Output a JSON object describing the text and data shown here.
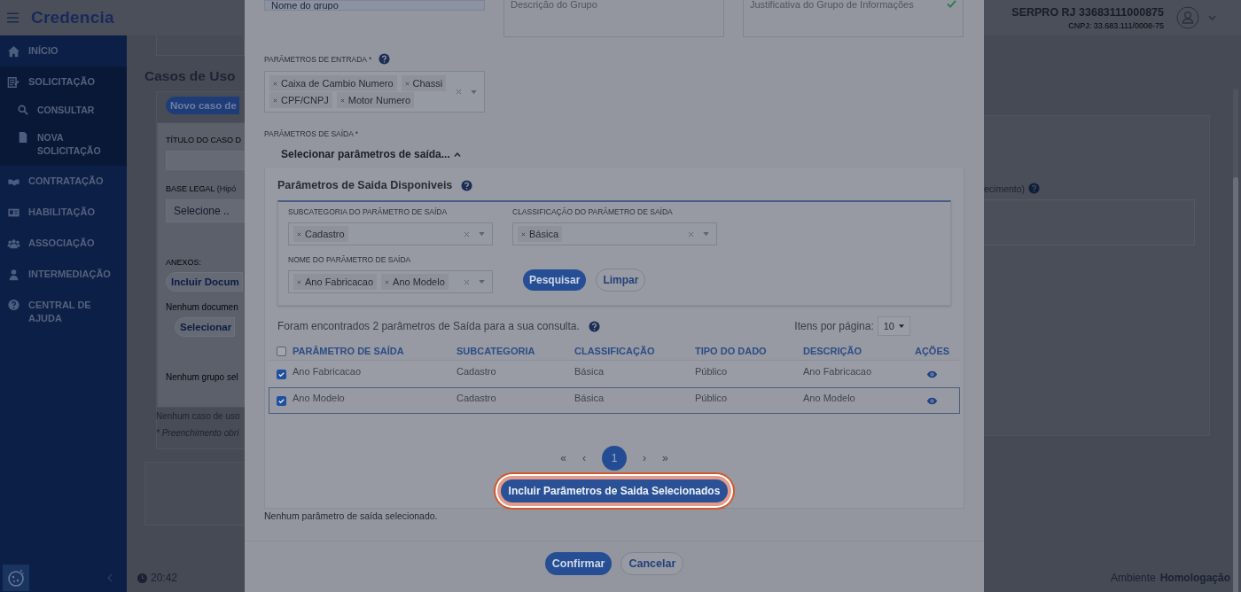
{
  "header": {
    "logo": "Credencia",
    "company_name": "SERPRO RJ 33683111000875",
    "company_id": "CNPJ: 33.683.111/0008-75"
  },
  "sidebar": {
    "items": [
      {
        "label": "INÍCIO",
        "expanded": false
      },
      {
        "label": "SOLICITAÇÃO",
        "expanded": true,
        "children": [
          {
            "label": "CONSULTAR"
          },
          {
            "label": "NOVA SOLICITAÇÃO"
          }
        ]
      },
      {
        "label": "CONTRATAÇÃO",
        "expanded": false
      },
      {
        "label": "HABILITAÇÃO",
        "expanded": false
      },
      {
        "label": "ASSOCIAÇÃO",
        "expanded": false
      },
      {
        "label": "INTERMEDIAÇÃO",
        "expanded": false
      },
      {
        "label": "CENTRAL DE AJUDA",
        "expanded": false
      }
    ]
  },
  "footer": {
    "time": "20:42",
    "environment_label": "Ambiente",
    "environment": "Homologação"
  },
  "background": {
    "section_title": "Casos de Uso",
    "new_button": "Novo caso de",
    "title_label": "TÍTULO DO CASO D",
    "legal_label": "BASE LEGAL",
    "legal_hint": "(Hipó",
    "legal_placeholder": "Selecione ..",
    "attachments_label": "ANEXOS:",
    "include_document_button": "Incluir Docum",
    "no_document_text": "Nenhum documen",
    "select_button": "Selecionar",
    "no_group_text": "Nenhum grupo sel",
    "no_use_case_text": "Nenhum caso de uso",
    "required_note": "* Preenchimento obri",
    "right_label": "ecimento)"
  },
  "modal": {
    "group_name": {
      "value": "Nome do grupo"
    },
    "group_description": {
      "placeholder": "Descrição do Grupo"
    },
    "justification": {
      "placeholder": "Justificativa do Grupo de Informações",
      "valid": true
    },
    "input_params": {
      "label": "PARÂMETROS DE ENTRADA *",
      "tags": [
        "Caixa de Cambio Numero",
        "Chassi",
        "CPF/CNPJ",
        "Motor Numero"
      ]
    },
    "output_params": {
      "label": "PARÂMETROS DE SAÍDA *",
      "toggle": "Selecionar parâmetros de saída...",
      "expanded": true
    },
    "available": {
      "title": "Parâmetros de Saida Disponiveis",
      "filters": [
        {
          "label": "SUBCATEGORIA DO PARÂMETRO DE SAÍDA",
          "tags": [
            "Cadastro"
          ]
        },
        {
          "label": "CLASSIFICAÇÃO DO PARÂMETRO DE SAÍDA",
          "tags": [
            "Básica"
          ]
        },
        {
          "label": "NOME DO PARÂMETRO DE SAÍDA",
          "tags": [
            "Ano Fabricacao",
            "Ano Modelo"
          ]
        }
      ],
      "search_button": "Pesquisar",
      "clear_button": "Limpar",
      "result_text": "Foram encontrados 2 parâmetros de Saída para a sua consulta.",
      "per_page_label": "Itens por página:",
      "per_page": "10",
      "table": {
        "all_checked": false,
        "columns": [
          "PARÂMETRO DE SAÍDA",
          "SUBCATEGORIA",
          "CLASSIFICAÇÃO",
          "TIPO DO DADO",
          "DESCRIÇÃO",
          "AÇÕES"
        ],
        "rows": [
          {
            "checked": true,
            "highlighted": false,
            "cells": [
              "Ano Fabricacao",
              "Cadastro",
              "Básica",
              "Público",
              "Ano Fabricacao"
            ]
          },
          {
            "checked": true,
            "highlighted": true,
            "cells": [
              "Ano Modelo",
              "Cadastro",
              "Básica",
              "Público",
              "Ano Modelo"
            ]
          }
        ]
      },
      "pagination": {
        "first": "«",
        "prev": "‹",
        "pages": [
          {
            "label": "1",
            "selected": true
          }
        ],
        "next": "›",
        "last": "»"
      },
      "include_button": {
        "label": "Incluir Parâmetros de Saida Selecionados",
        "focused": true
      }
    },
    "empty_text": "Nenhum parâmetro de saída selecionado.",
    "confirm_button": "Confirmar",
    "cancel_button": "Cancelar"
  }
}
